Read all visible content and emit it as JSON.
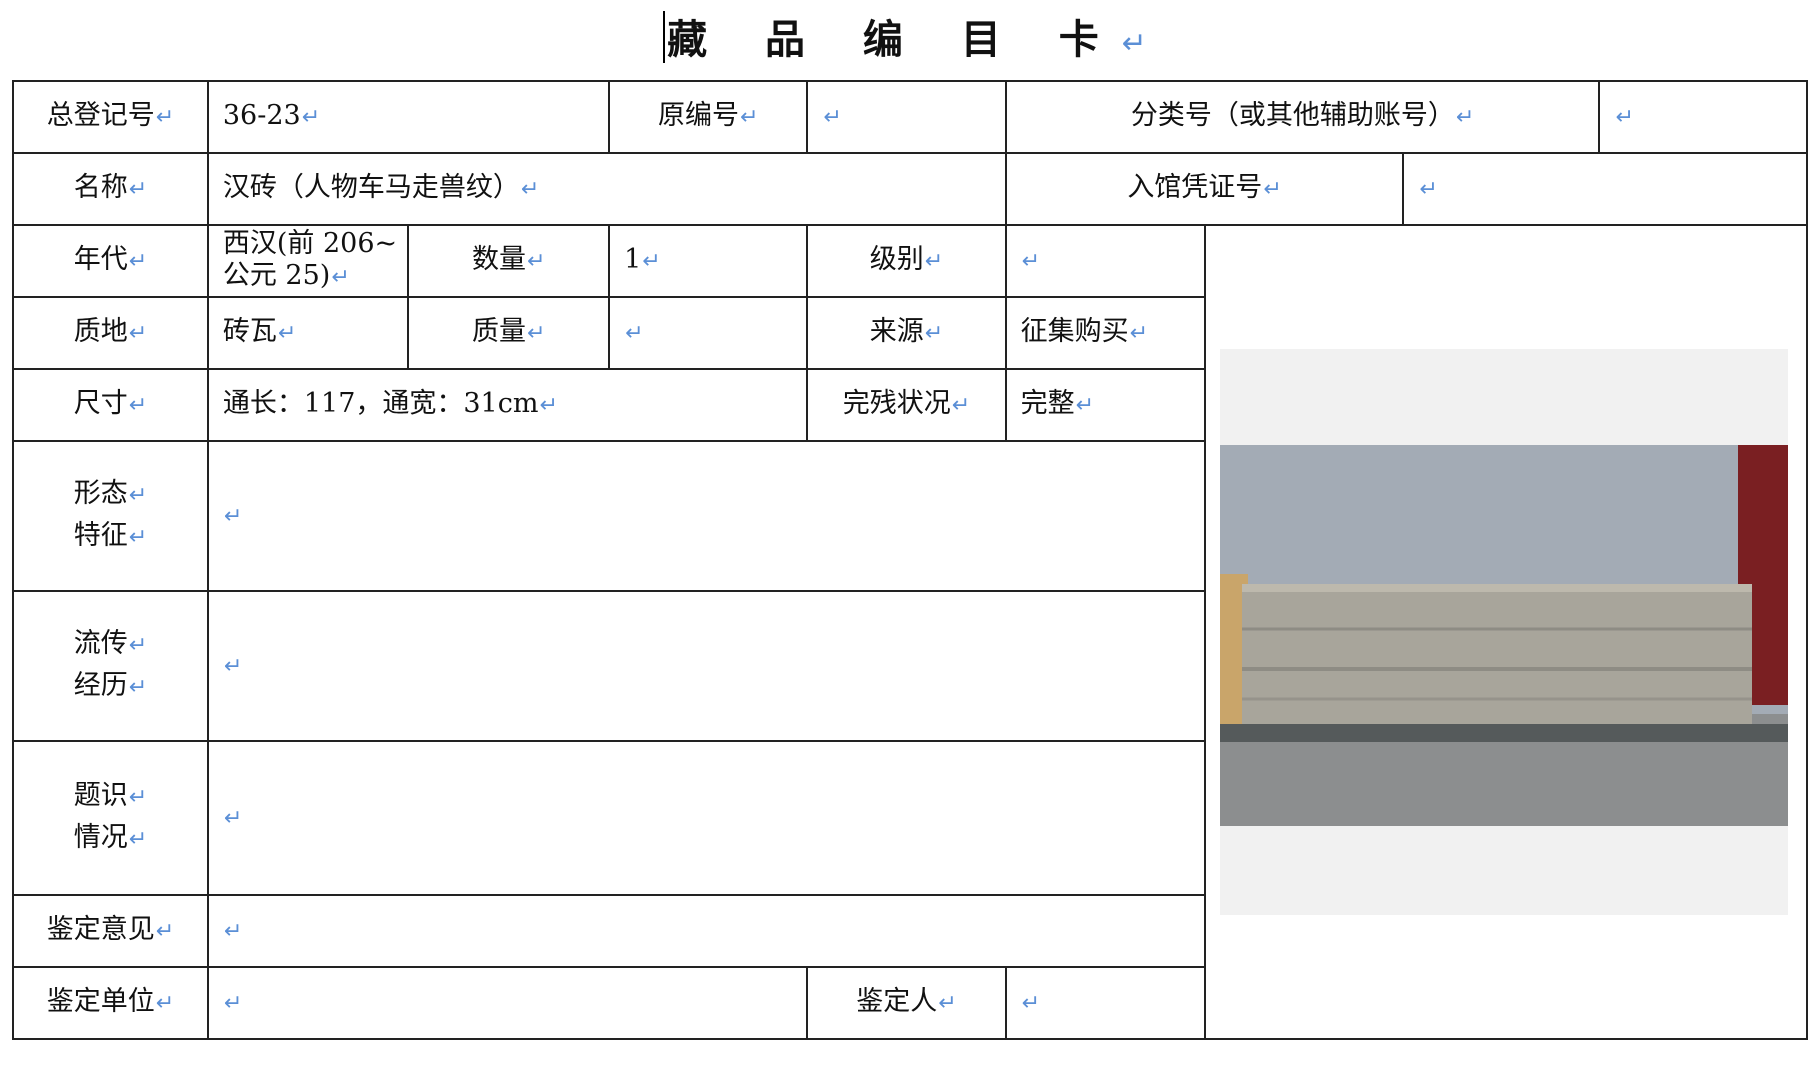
{
  "title": "藏 品 编 目 卡",
  "mark": "↵",
  "fields": {
    "total_reg_no": {
      "label": "总登记号",
      "value": "36-23"
    },
    "orig_no": {
      "label": "原编号",
      "value": ""
    },
    "class_no": {
      "label": "分类号（或其他辅助账号）",
      "value": ""
    },
    "name": {
      "label": "名称",
      "value": "汉砖（人物车马走兽纹）"
    },
    "voucher_no": {
      "label": "入馆凭证号",
      "value": ""
    },
    "era": {
      "label": "年代",
      "value_line1": "西汉(前 206~",
      "value_line2": "公元 25)"
    },
    "quantity": {
      "label": "数量",
      "value": "1"
    },
    "grade": {
      "label": "级别",
      "value": ""
    },
    "material": {
      "label": "质地",
      "value": "砖瓦"
    },
    "weight": {
      "label": "质量",
      "value": ""
    },
    "source": {
      "label": "来源",
      "value": "征集购买"
    },
    "size": {
      "label": "尺寸",
      "value": "通长：117，通宽：31cm"
    },
    "condition": {
      "label": "完残状况",
      "value": "完整"
    },
    "form": {
      "label_line1": "形态",
      "label_line2": "特征",
      "value": ""
    },
    "history": {
      "label_line1": "流传",
      "label_line2": "经历",
      "value": ""
    },
    "inscription": {
      "label_line1": "题识",
      "label_line2": "情况",
      "value": ""
    },
    "appraisal_opinion": {
      "label": "鉴定意见",
      "value": ""
    },
    "appraisal_unit": {
      "label": "鉴定单位",
      "value": ""
    },
    "appraiser": {
      "label": "鉴定人",
      "value": ""
    }
  },
  "photo": {
    "bg_color": "#f1f1f1",
    "wall_color": "#9ea6b0",
    "brick_color": "#a8a59b",
    "floor_color": "#8c8e8f",
    "pillar_color": "#7a1f22",
    "wood_color": "#c9a56a"
  }
}
